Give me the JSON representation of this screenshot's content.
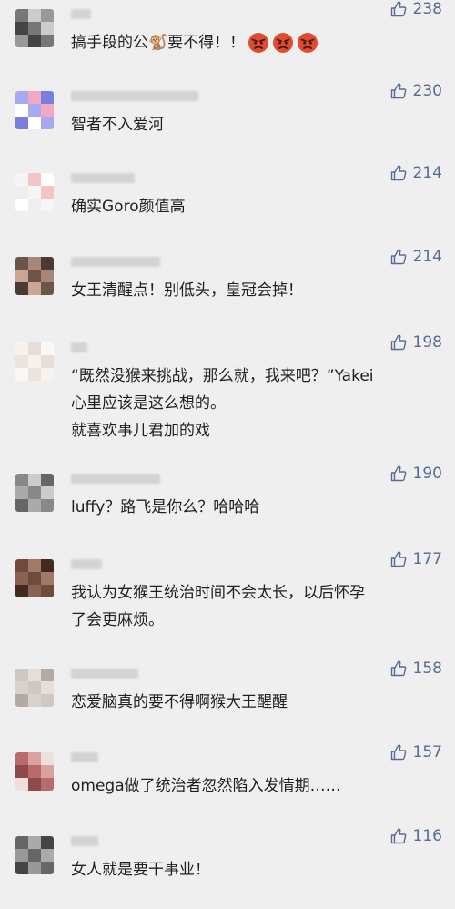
{
  "comments": [
    {
      "likes": "238",
      "text": "搞手段的公🐒要不得！！",
      "avatar_colors": [
        "#777",
        "#ccc",
        "#999",
        "#444"
      ],
      "emoji": [
        "angry-face",
        "angry-face",
        "angry-face"
      ]
    },
    {
      "likes": "230",
      "text": "智者不入爱河",
      "avatar_colors": [
        "#a7aaf0",
        "#f0a8c3",
        "#7a7de0",
        "#ffffff"
      ],
      "emoji": []
    },
    {
      "likes": "214",
      "text": "确实Goro颜值高",
      "avatar_colors": [
        "#f5f5f5",
        "#f3c5c5",
        "#ffffff",
        "#eeeeee"
      ],
      "emoji": []
    },
    {
      "likes": "214",
      "text": "女王清醒点！别低头，皇冠会掉！",
      "avatar_colors": [
        "#6b5448",
        "#a88778",
        "#4a3a33",
        "#c9a596"
      ],
      "emoji": []
    },
    {
      "likes": "198",
      "text": "“既然没猴来挑战，那么就，我来吧？”Yakei\n心里应该是这么想的。\n就喜欢事儿君加的戏",
      "avatar_colors": [
        "#f7f2ee",
        "#e8ddd6",
        "#faf7f4",
        "#ede4de"
      ],
      "emoji": []
    },
    {
      "likes": "190",
      "text": "luffy？路飞是你么？哈哈哈",
      "avatar_colors": [
        "#888",
        "#ccc",
        "#666",
        "#aaa"
      ],
      "emoji": []
    },
    {
      "likes": "177",
      "text": "我认为女猴王统治时间不会太长，以后怀孕\n了会更麻烦。",
      "avatar_colors": [
        "#6e4b3b",
        "#a17a67",
        "#3f2b22",
        "#8a6252"
      ],
      "emoji": []
    },
    {
      "likes": "158",
      "text": "恋爱脑真的要不得啊猴大王醒醒",
      "avatar_colors": [
        "#cfc7c2",
        "#e6dfd9",
        "#b5aaa3",
        "#d9d1cb"
      ],
      "emoji": []
    },
    {
      "likes": "157",
      "text": "omega做了统治者忽然陷入发情期……",
      "avatar_colors": [
        "#b86b6b",
        "#dba0a0",
        "#f0dede",
        "#8c4a4a"
      ],
      "emoji": []
    },
    {
      "likes": "116",
      "text": "女人就是要干事业！",
      "avatar_colors": [
        "#666",
        "#aaa",
        "#444",
        "#999"
      ],
      "emoji": []
    }
  ]
}
